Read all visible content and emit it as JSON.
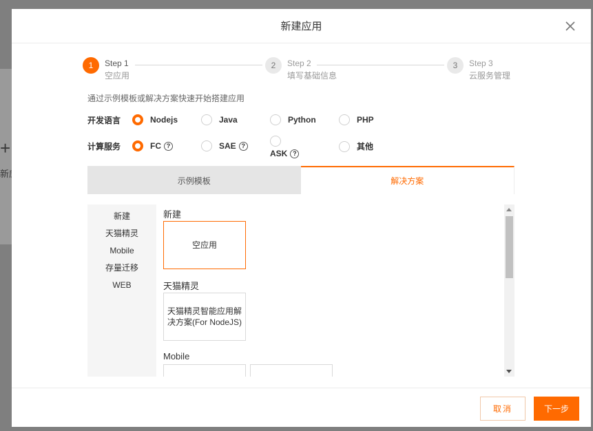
{
  "background": {
    "plus": "+",
    "text": "新应"
  },
  "modal": {
    "title": "新建应用"
  },
  "steps": [
    {
      "number": "1",
      "title": "Step 1",
      "subtitle": "空应用",
      "active": true
    },
    {
      "number": "2",
      "title": "Step 2",
      "subtitle": "填写基础信息",
      "active": false
    },
    {
      "number": "3",
      "title": "Step 3",
      "subtitle": "云服务管理",
      "active": false
    }
  ],
  "hint": "通过示例模板或解决方案快速开始搭建应用",
  "language": {
    "label": "开发语言",
    "options": [
      "Nodejs",
      "Java",
      "Python",
      "PHP"
    ],
    "selected": "Nodejs"
  },
  "compute": {
    "label": "计算服务",
    "options": [
      "FC",
      "SAE",
      "ASK",
      "其他"
    ],
    "selected": "FC",
    "help_icon": "?"
  },
  "tabs": [
    "示例模板",
    "解决方案"
  ],
  "active_tab": "解决方案",
  "categories": [
    "新建",
    "天猫精灵",
    "Mobile",
    "存量迁移",
    "WEB"
  ],
  "sections": [
    {
      "title": "新建",
      "cards": [
        "空应用"
      ]
    },
    {
      "title": "天猫精灵",
      "cards": [
        "天猫精灵智能应用解决方案(For NodeJS)"
      ]
    },
    {
      "title": "Mobile",
      "cards": [
        "",
        ""
      ]
    }
  ],
  "footer": {
    "cancel": "取消",
    "next": "下一步"
  },
  "colors": {
    "accent": "#ff6a00"
  }
}
